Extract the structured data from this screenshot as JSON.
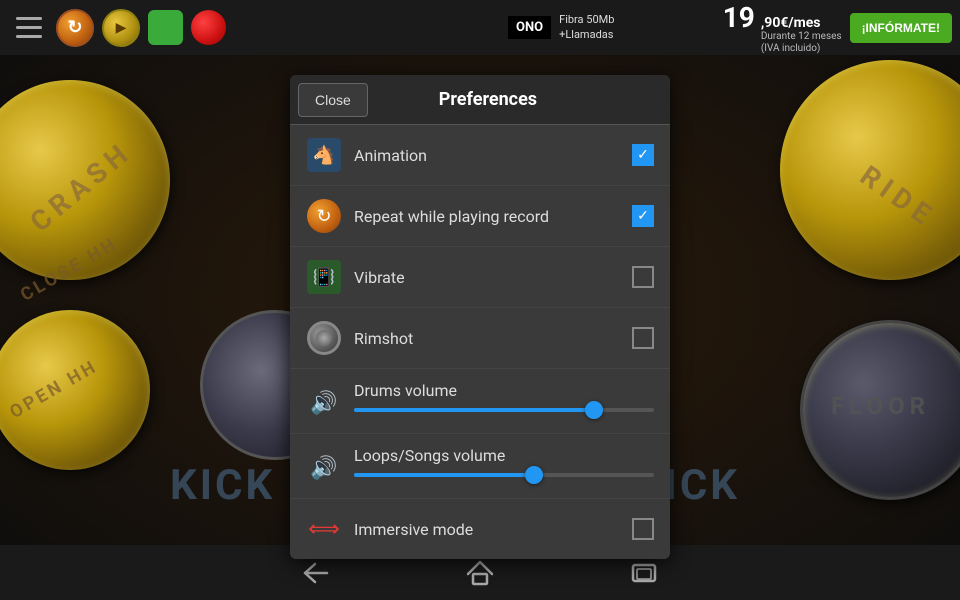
{
  "toolbar": {
    "menu_icon": "☰",
    "icons": [
      "menu",
      "sync-orange",
      "record-gold",
      "green-square",
      "red-circle"
    ]
  },
  "ad": {
    "brand": "ONO",
    "line1": "Fibra 50Mb",
    "line2": "+Llamadas",
    "price": "19",
    "decimal": ",90€/mes",
    "detail1": "Durante 12 meses",
    "detail2": "(IVA incluido)",
    "button": "¡INFÓRMATE!"
  },
  "background": {
    "crash_label": "CRASH",
    "open_hh_label": "OPEN HH",
    "close_hh_label": "CLOSE HH",
    "ride_label": "RIDE",
    "floor_label": "FLOOR",
    "kick_left": "KICK",
    "kick_right": "KICK"
  },
  "preferences": {
    "close_button": "Close",
    "title": "Preferences",
    "items": [
      {
        "id": "animation",
        "label": "Animation",
        "icon_type": "animation",
        "checked": true
      },
      {
        "id": "repeat",
        "label": "Repeat while playing record",
        "icon_type": "repeat",
        "checked": true
      },
      {
        "id": "vibrate",
        "label": "Vibrate",
        "icon_type": "vibrate",
        "checked": false
      },
      {
        "id": "rimshot",
        "label": "Rimshot",
        "icon_type": "rimshot",
        "checked": false
      }
    ],
    "drums_volume": {
      "label": "Drums volume",
      "value": 80,
      "icon_type": "volume-blue"
    },
    "loops_volume": {
      "label": "Loops/Songs volume",
      "value": 60,
      "icon_type": "volume-purple"
    },
    "immersive": {
      "label": "Immersive mode",
      "icon_type": "immersive",
      "checked": false
    }
  },
  "bottom_nav": {
    "back_icon": "←",
    "home_icon": "⌂",
    "recent_icon": "▭"
  }
}
